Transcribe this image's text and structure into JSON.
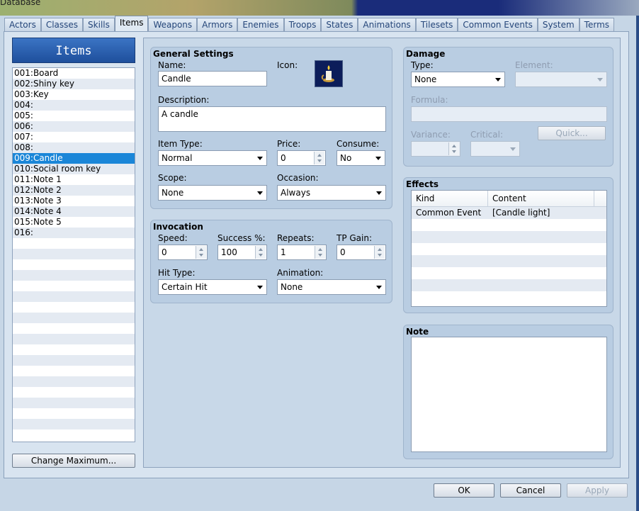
{
  "window": {
    "title": "Database"
  },
  "tabs": [
    "Actors",
    "Classes",
    "Skills",
    "Items",
    "Weapons",
    "Armors",
    "Enemies",
    "Troops",
    "States",
    "Animations",
    "Tilesets",
    "Common Events",
    "System",
    "Terms"
  ],
  "active_tab": "Items",
  "items_panel": {
    "header": "Items",
    "items": [
      "001:Board",
      "002:Shiny key",
      "003:Key",
      "004:",
      "005:",
      "006:",
      "007:",
      "008:",
      "009:Candle",
      "010:Social room key",
      "011:Note 1",
      "012:Note 2",
      "013:Note 3",
      "014:Note 4",
      "015:Note 5",
      "016:"
    ],
    "selected_index": 8,
    "change_max_label": "Change Maximum..."
  },
  "general": {
    "title": "General Settings",
    "name_label": "Name:",
    "name_value": "Candle",
    "icon_label": "Icon:",
    "description_label": "Description:",
    "description_value": "A candle",
    "item_type_label": "Item Type:",
    "item_type_value": "Normal",
    "price_label": "Price:",
    "price_value": "0",
    "consume_label": "Consume:",
    "consume_value": "No",
    "scope_label": "Scope:",
    "scope_value": "None",
    "occasion_label": "Occasion:",
    "occasion_value": "Always"
  },
  "invocation": {
    "title": "Invocation",
    "speed_label": "Speed:",
    "speed_value": "0",
    "success_label": "Success %:",
    "success_value": "100",
    "repeats_label": "Repeats:",
    "repeats_value": "1",
    "tp_label": "TP Gain:",
    "tp_value": "0",
    "hit_type_label": "Hit Type:",
    "hit_type_value": "Certain Hit",
    "animation_label": "Animation:",
    "animation_value": "None"
  },
  "damage": {
    "title": "Damage",
    "type_label": "Type:",
    "type_value": "None",
    "element_label": "Element:",
    "formula_label": "Formula:",
    "variance_label": "Variance:",
    "critical_label": "Critical:",
    "quick_label": "Quick..."
  },
  "effects": {
    "title": "Effects",
    "columns": [
      "Kind",
      "Content"
    ],
    "rows": [
      {
        "kind": "Common Event",
        "content": "[Candle light]"
      }
    ]
  },
  "note": {
    "title": "Note",
    "value": ""
  },
  "buttons": {
    "ok": "OK",
    "cancel": "Cancel",
    "apply": "Apply"
  },
  "colors": {
    "selection": "#1a86d8",
    "header": "#2a62b4"
  }
}
